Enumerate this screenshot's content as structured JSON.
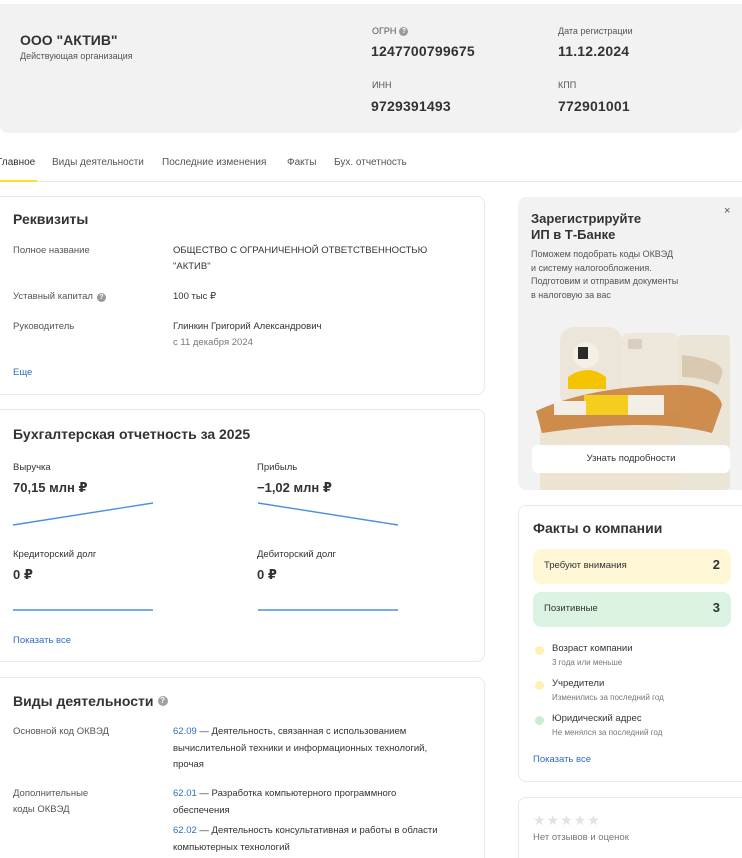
{
  "header": {
    "company_name": "ООО \"АКТИВ\"",
    "status": "Действующая организация",
    "ogrn_label": "ОГРН",
    "ogrn_value": "1247700799675",
    "reg_date_label": "Дата регистрации",
    "reg_date_value": "11.12.2024",
    "inn_label": "ИНН",
    "inn_value": "9729391493",
    "kpp_label": "КПП",
    "kpp_value": "772901001"
  },
  "tabs": [
    {
      "label": "Главное",
      "active": true
    },
    {
      "label": "Виды деятельности",
      "active": false
    },
    {
      "label": "Последние изменения",
      "active": false
    },
    {
      "label": "Факты",
      "active": false
    },
    {
      "label": "Бух. отчетность",
      "active": false
    }
  ],
  "requisites": {
    "title": "Реквизиты",
    "full_name_label": "Полное название",
    "full_name_line1": "ОБЩЕСТВО С ОГРАНИЧЕННОЙ ОТВЕТСТВЕННОСТЬЮ",
    "full_name_line2": "\"АКТИВ\"",
    "capital_label": "Уставный капитал",
    "capital_value": "100 тыс ₽",
    "head_label": "Руководитель",
    "head_name": "Глинкин Григорий Александрович",
    "head_since": "с 11 декабря 2024",
    "more_link": "Еще"
  },
  "finance": {
    "title": "Бухгалтерская отчетность за 2025",
    "revenue_label": "Выручка",
    "revenue_value": "70,15 млн ₽",
    "profit_label": "Прибыль",
    "profit_value": "−1,02 млн ₽",
    "creditor_label": "Кредиторский долг",
    "creditor_value": "0 ₽",
    "debtor_label": "Дебиторский долг",
    "debtor_value": "0 ₽",
    "show_all": "Показать все",
    "line_color": "#4a90e2"
  },
  "activities": {
    "title": "Виды деятельности",
    "main_label": "Основной код ОКВЭД",
    "main_code": "62.09",
    "main_text_1": " — Деятельность, связанная с использованием",
    "main_text_2": "вычислительной техники и информационных технологий,",
    "main_text_3": "прочая",
    "extra_label_1": "Дополнительные",
    "extra_label_2": "коды ОКВЭД",
    "extra": [
      {
        "code": "62.01",
        "text_1": " — Разработка компьютерного программного",
        "text_2": "обеспечения"
      },
      {
        "code": "62.02",
        "text_1": " — Деятельность консультативная и работы в области",
        "text_2": "компьютерных технологий"
      }
    ]
  },
  "promo": {
    "title_1": "Зарегистрируйте",
    "title_2": "ИП в Т-Банке",
    "text_1": "Поможем подобрать коды ОКВЭД",
    "text_2": "и систему налогообложения.",
    "text_3": "Подготовим и отправим документы",
    "text_4": "в налоговую за вас",
    "close": "×",
    "button": "Узнать подробности"
  },
  "facts": {
    "title": "Факты о компании",
    "attention_label": "Требуют внимания",
    "attention_count": "2",
    "positive_label": "Позитивные",
    "positive_count": "3",
    "items": [
      {
        "title": "Возраст компании",
        "sub": "3 года или меньше",
        "color": "#fff1b3"
      },
      {
        "title": "Учредители",
        "sub": "Изменились за последний год",
        "color": "#fff1b3"
      },
      {
        "title": "Юридический адрес",
        "sub": "Не менялся за последний год",
        "color": "#c9ecd2"
      }
    ],
    "show_all": "Показать все",
    "attention_color": "#fff6d6",
    "positive_color": "#dcf3e2"
  },
  "reviews": {
    "stars": "★★★★★",
    "text": "Нет отзывов и оценок"
  }
}
